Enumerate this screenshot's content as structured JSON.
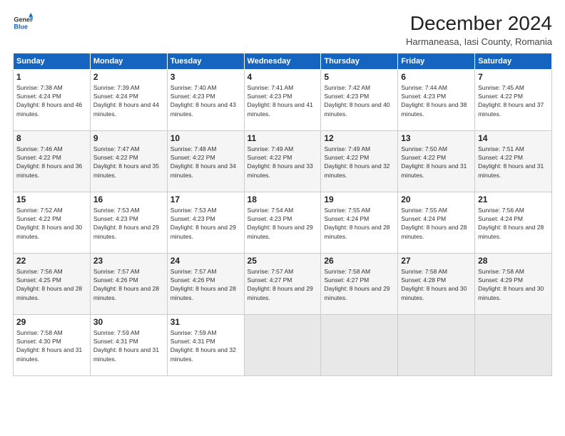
{
  "header": {
    "title": "December 2024",
    "subtitle": "Harmaneasa, Iasi County, Romania"
  },
  "columns": [
    "Sunday",
    "Monday",
    "Tuesday",
    "Wednesday",
    "Thursday",
    "Friday",
    "Saturday"
  ],
  "weeks": [
    [
      {
        "day": "1",
        "sunrise": "7:38 AM",
        "sunset": "4:24 PM",
        "daylight": "8 hours and 46 minutes."
      },
      {
        "day": "2",
        "sunrise": "7:39 AM",
        "sunset": "4:24 PM",
        "daylight": "8 hours and 44 minutes."
      },
      {
        "day": "3",
        "sunrise": "7:40 AM",
        "sunset": "4:23 PM",
        "daylight": "8 hours and 43 minutes."
      },
      {
        "day": "4",
        "sunrise": "7:41 AM",
        "sunset": "4:23 PM",
        "daylight": "8 hours and 41 minutes."
      },
      {
        "day": "5",
        "sunrise": "7:42 AM",
        "sunset": "4:23 PM",
        "daylight": "8 hours and 40 minutes."
      },
      {
        "day": "6",
        "sunrise": "7:44 AM",
        "sunset": "4:23 PM",
        "daylight": "8 hours and 38 minutes."
      },
      {
        "day": "7",
        "sunrise": "7:45 AM",
        "sunset": "4:22 PM",
        "daylight": "8 hours and 37 minutes."
      }
    ],
    [
      {
        "day": "8",
        "sunrise": "7:46 AM",
        "sunset": "4:22 PM",
        "daylight": "8 hours and 36 minutes."
      },
      {
        "day": "9",
        "sunrise": "7:47 AM",
        "sunset": "4:22 PM",
        "daylight": "8 hours and 35 minutes."
      },
      {
        "day": "10",
        "sunrise": "7:48 AM",
        "sunset": "4:22 PM",
        "daylight": "8 hours and 34 minutes."
      },
      {
        "day": "11",
        "sunrise": "7:49 AM",
        "sunset": "4:22 PM",
        "daylight": "8 hours and 33 minutes."
      },
      {
        "day": "12",
        "sunrise": "7:49 AM",
        "sunset": "4:22 PM",
        "daylight": "8 hours and 32 minutes."
      },
      {
        "day": "13",
        "sunrise": "7:50 AM",
        "sunset": "4:22 PM",
        "daylight": "8 hours and 31 minutes."
      },
      {
        "day": "14",
        "sunrise": "7:51 AM",
        "sunset": "4:22 PM",
        "daylight": "8 hours and 31 minutes."
      }
    ],
    [
      {
        "day": "15",
        "sunrise": "7:52 AM",
        "sunset": "4:22 PM",
        "daylight": "8 hours and 30 minutes."
      },
      {
        "day": "16",
        "sunrise": "7:53 AM",
        "sunset": "4:23 PM",
        "daylight": "8 hours and 29 minutes."
      },
      {
        "day": "17",
        "sunrise": "7:53 AM",
        "sunset": "4:23 PM",
        "daylight": "8 hours and 29 minutes."
      },
      {
        "day": "18",
        "sunrise": "7:54 AM",
        "sunset": "4:23 PM",
        "daylight": "8 hours and 29 minutes."
      },
      {
        "day": "19",
        "sunrise": "7:55 AM",
        "sunset": "4:24 PM",
        "daylight": "8 hours and 28 minutes."
      },
      {
        "day": "20",
        "sunrise": "7:55 AM",
        "sunset": "4:24 PM",
        "daylight": "8 hours and 28 minutes."
      },
      {
        "day": "21",
        "sunrise": "7:56 AM",
        "sunset": "4:24 PM",
        "daylight": "8 hours and 28 minutes."
      }
    ],
    [
      {
        "day": "22",
        "sunrise": "7:56 AM",
        "sunset": "4:25 PM",
        "daylight": "8 hours and 28 minutes."
      },
      {
        "day": "23",
        "sunrise": "7:57 AM",
        "sunset": "4:26 PM",
        "daylight": "8 hours and 28 minutes."
      },
      {
        "day": "24",
        "sunrise": "7:57 AM",
        "sunset": "4:26 PM",
        "daylight": "8 hours and 28 minutes."
      },
      {
        "day": "25",
        "sunrise": "7:57 AM",
        "sunset": "4:27 PM",
        "daylight": "8 hours and 29 minutes."
      },
      {
        "day": "26",
        "sunrise": "7:58 AM",
        "sunset": "4:27 PM",
        "daylight": "8 hours and 29 minutes."
      },
      {
        "day": "27",
        "sunrise": "7:58 AM",
        "sunset": "4:28 PM",
        "daylight": "8 hours and 30 minutes."
      },
      {
        "day": "28",
        "sunrise": "7:58 AM",
        "sunset": "4:29 PM",
        "daylight": "8 hours and 30 minutes."
      }
    ],
    [
      {
        "day": "29",
        "sunrise": "7:58 AM",
        "sunset": "4:30 PM",
        "daylight": "8 hours and 31 minutes."
      },
      {
        "day": "30",
        "sunrise": "7:59 AM",
        "sunset": "4:31 PM",
        "daylight": "8 hours and 31 minutes."
      },
      {
        "day": "31",
        "sunrise": "7:59 AM",
        "sunset": "4:31 PM",
        "daylight": "8 hours and 32 minutes."
      },
      null,
      null,
      null,
      null
    ]
  ]
}
